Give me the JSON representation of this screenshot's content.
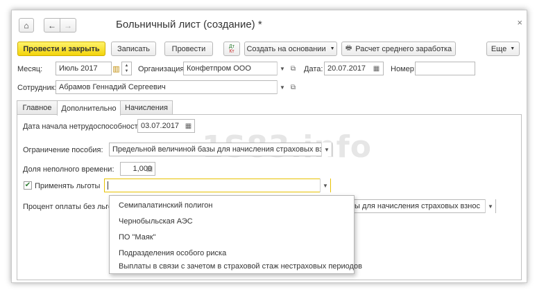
{
  "window": {
    "title": "Больничный лист (создание) *",
    "close": "×"
  },
  "nav": {
    "home": "⌂",
    "back": "←",
    "forward": "→"
  },
  "toolbar": {
    "post_close": "Провести и закрыть",
    "save": "Записать",
    "post": "Провести",
    "create_based_on": "Создать на основании",
    "avg_earnings": "Расчет среднего заработка",
    "more": "Еще"
  },
  "header": {
    "month_label": "Месяц:",
    "month_value": "Июль 2017",
    "org_label": "Организация:",
    "org_value": "Конфетпром ООО",
    "date_label": "Дата:",
    "date_value": "20.07.2017",
    "number_label": "Номер:",
    "number_value": "",
    "employee_label": "Сотрудник:",
    "employee_value": "Абрамов Геннадий Сергеевич"
  },
  "tabs": [
    "Главное",
    "Дополнительно",
    "Начисления"
  ],
  "additional": {
    "start_label": "Дата начала нетрудоспособности:",
    "start_value": "03.07.2017",
    "limit_label": "Ограничение пособия:",
    "limit_value": "Предельной величиной базы для начисления страховых взнос",
    "parttime_label": "Доля неполного времени:",
    "parttime_value": "1,000",
    "benefits_label": "Применять льготы",
    "benefits_checked": true,
    "benefits_value": "",
    "percent_label": "Процент оплаты без льгот",
    "percent_value_tail": "зы для начисления страховых взнос"
  },
  "dropdown": {
    "items": [
      "Семипалатинский полигон",
      "Чернобыльская АЭС",
      "ПО \"Маяк\"",
      "Подразделения особого риска",
      "Выплаты в связи с зачетом в страховой стаж нестраховых периодов"
    ]
  },
  "watermark": "1S83.info"
}
